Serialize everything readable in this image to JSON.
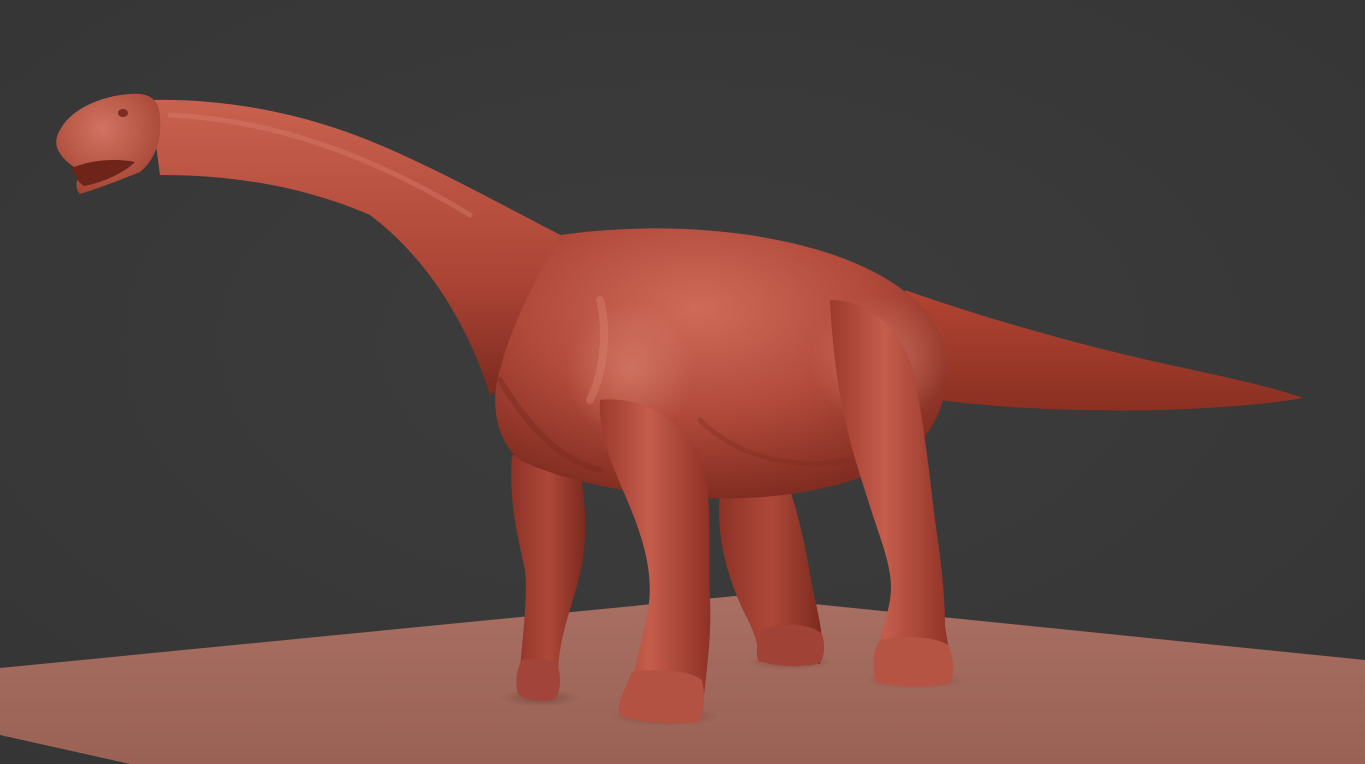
{
  "viewport": {
    "background_color": "#393939",
    "ground_color": "#a0685b",
    "model_color": "#b54b3d",
    "model_highlight_color": "#d77868",
    "model_shadow_color": "#6f2218",
    "objects": [
      {
        "name": "sauropod-sculpt",
        "kind": "mesh"
      },
      {
        "name": "ground-plane",
        "kind": "mesh"
      }
    ]
  }
}
